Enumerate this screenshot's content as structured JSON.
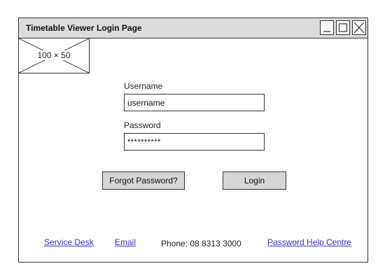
{
  "window": {
    "title": "Timetable Viewer Login Page"
  },
  "logo": {
    "placeholder_label": "100 × 50"
  },
  "form": {
    "username_label": "Username",
    "username_value": "username",
    "password_label": "Password",
    "password_value": "**********"
  },
  "buttons": {
    "forgot_label": "Forgot Password?",
    "login_label": "Login"
  },
  "footer": {
    "service_desk": "Service Desk",
    "email": "Email",
    "phone": "Phone: 08 8313 3000",
    "password_help": "Password Help Centre"
  },
  "colors": {
    "titlebar_bg": "#dcdcdc",
    "button_bg": "#d6d6d6",
    "link": "#3b32d6"
  },
  "icons": {
    "minimize": "minimize-icon",
    "maximize": "maximize-icon",
    "close": "close-icon"
  }
}
